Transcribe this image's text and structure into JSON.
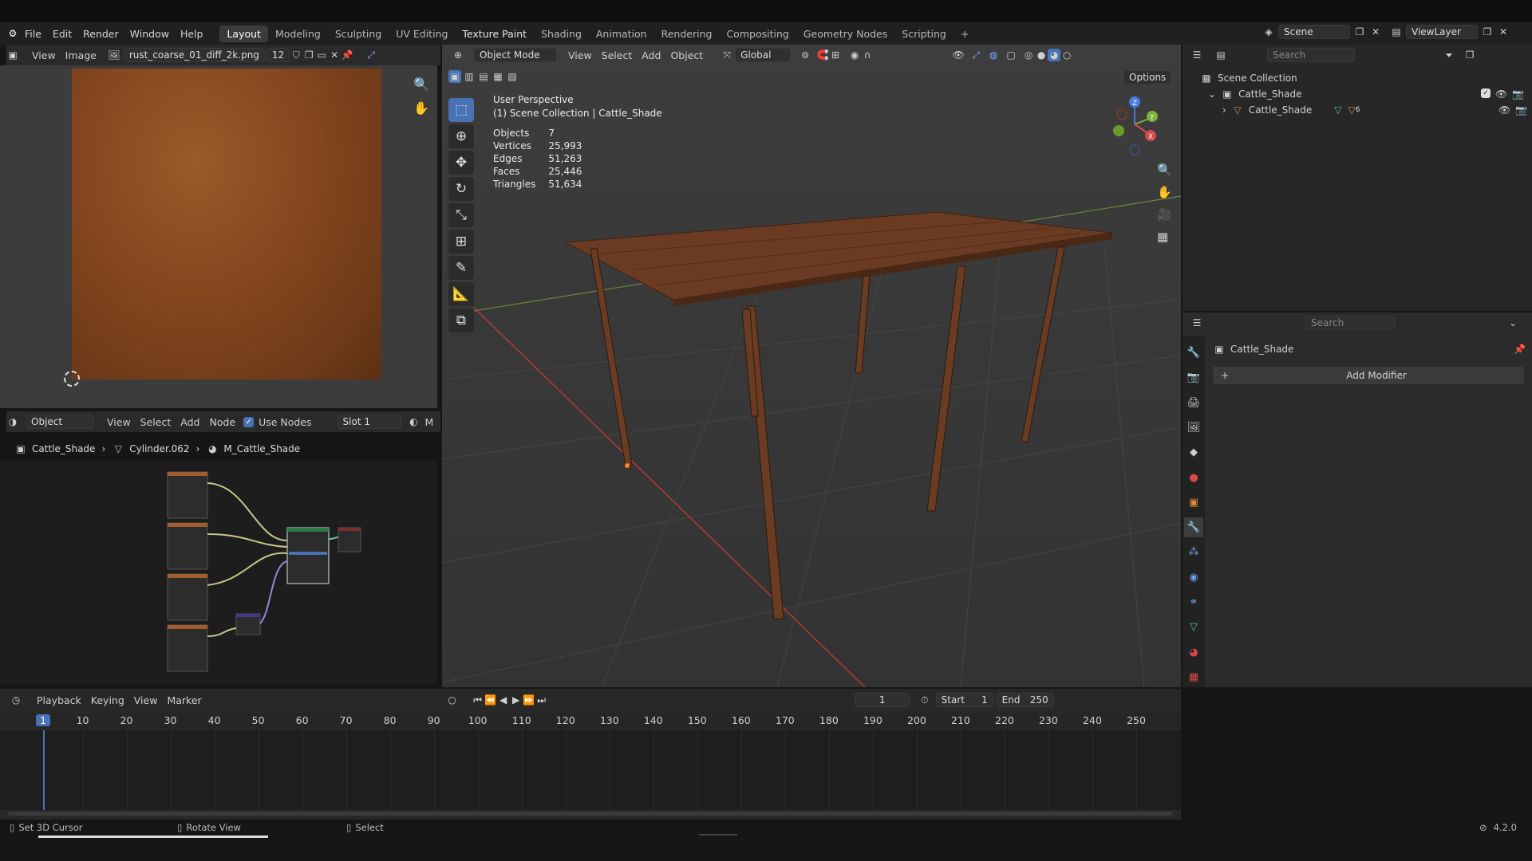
{
  "topbar": {
    "menus": [
      "File",
      "Edit",
      "Render",
      "Window",
      "Help"
    ],
    "workspaces": [
      "Layout",
      "Modeling",
      "Sculpting",
      "UV Editing",
      "Texture Paint",
      "Shading",
      "Animation",
      "Rendering",
      "Compositing",
      "Geometry Nodes",
      "Scripting"
    ],
    "active_workspace": "Layout",
    "add_workspace": "+",
    "scene_label": "Scene",
    "viewlayer_label": "ViewLayer"
  },
  "image_editor": {
    "view_label": "View",
    "image_label": "Image",
    "filename": "rust_coarse_01_diff_2k.png",
    "users_count": "12",
    "texture_color": "#8a4d22"
  },
  "node_editor": {
    "object_dropdown": "Object",
    "menus": [
      "View",
      "Select",
      "Add",
      "Node"
    ],
    "use_nodes_label": "Use Nodes",
    "use_nodes_checked": true,
    "slot_dropdown": "Slot 1",
    "trailing_letter": "M",
    "breadcrumb": [
      "Cattle_Shade",
      "Cylinder.062",
      "M_Cattle_Shade"
    ]
  },
  "viewport": {
    "mode_dropdown": "Object Mode",
    "menus": [
      "View",
      "Select",
      "Add",
      "Object"
    ],
    "transform_dropdown": "Global",
    "options_label": "Options",
    "perspective_label": "User Perspective",
    "collection_label": "(1) Scene Collection | Cattle_Shade",
    "stats": [
      {
        "label": "Objects",
        "value": "7"
      },
      {
        "label": "Vertices",
        "value": "25,993"
      },
      {
        "label": "Edges",
        "value": "51,263"
      },
      {
        "label": "Faces",
        "value": "25,446"
      },
      {
        "label": "Triangles",
        "value": "51,634"
      }
    ],
    "gizmo": {
      "z": "Z",
      "y": "Y",
      "x": "X"
    }
  },
  "outliner": {
    "search_placeholder": "Search",
    "root": "Scene Collection",
    "collection": "Cattle_Shade",
    "object": "Cattle_Shade",
    "object_modifier_count": "6"
  },
  "properties": {
    "search_placeholder": "Search",
    "object_name": "Cattle_Shade",
    "add_modifier_label": "Add Modifier"
  },
  "timeline": {
    "menus": [
      "Playback",
      "Keying",
      "View",
      "Marker"
    ],
    "current_frame": "1",
    "start_label": "Start",
    "start_value": "1",
    "end_label": "End",
    "end_value": "250",
    "ticks": [
      "1",
      "10",
      "20",
      "30",
      "40",
      "50",
      "60",
      "70",
      "80",
      "90",
      "100",
      "110",
      "120",
      "130",
      "140",
      "150",
      "160",
      "170",
      "180",
      "190",
      "200",
      "210",
      "220",
      "230",
      "240",
      "250"
    ]
  },
  "statusbar": {
    "left_hint": "Set 3D Cursor",
    "mid_hint": "Rotate View",
    "right_hint": "Select",
    "version": "4.2.0"
  }
}
